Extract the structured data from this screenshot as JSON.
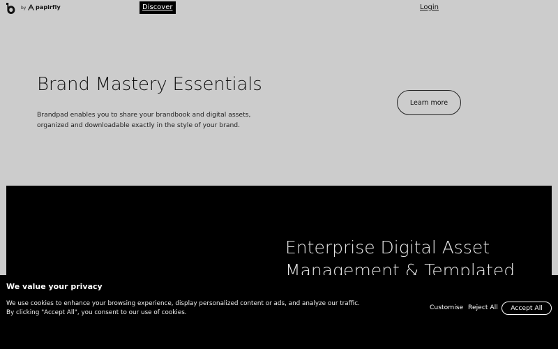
{
  "nav": {
    "logo_icon": "brandpad-b-icon",
    "by_text": "by",
    "partner_logo_icon": "papirfly-icon",
    "partner_name": "papirfly",
    "discover_label": "Discover",
    "login_label": "Login"
  },
  "hero": {
    "title": "Brand Mastery Essentials",
    "description": "Brandpad enables you to share your brandbook and digital assets, organized and downloadable exactly in the style of your brand.",
    "cta_label": "Learn more"
  },
  "dark_section": {
    "title_line1": "Enterprise Digital Asset",
    "title_line2": "Management & Templated"
  },
  "cookie": {
    "title": "We value your privacy",
    "text": "We use cookies to enhance your browsing experience, display personalized content or ads, and analyze our traffic. By clicking \"Accept All\", you consent to our use of cookies.",
    "customise_label": "Customise",
    "reject_label": "Reject All",
    "accept_label": "Accept All"
  },
  "colors": {
    "page_background": "#cccccc",
    "dark_background": "#000000",
    "text_dark": "#111111",
    "text_light": "#ffffff"
  }
}
